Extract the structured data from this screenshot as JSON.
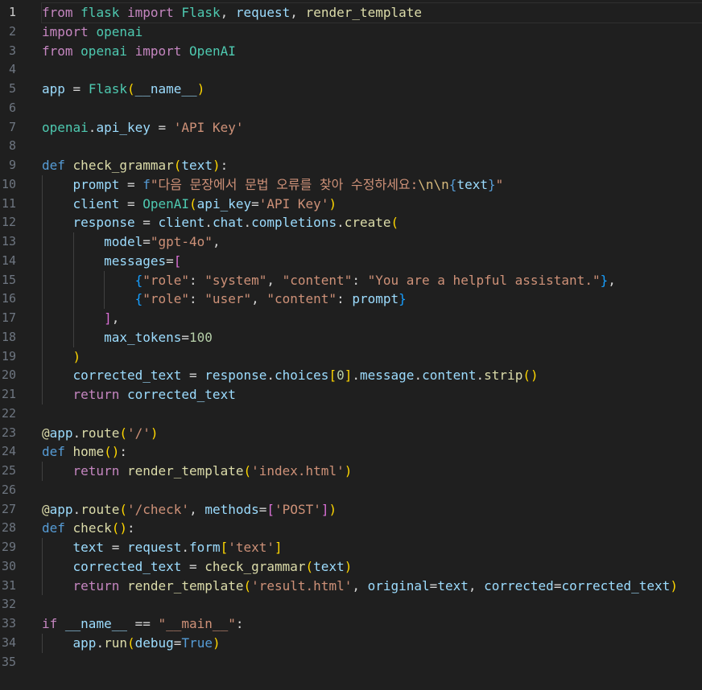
{
  "editor": {
    "language": "python",
    "active_line": 1,
    "colors": {
      "background": "#1f1f1f",
      "keyword_control": "#c586c0",
      "keyword": "#569cd6",
      "function": "#dcdcaa",
      "class": "#4ec9b0",
      "variable": "#9cdcfe",
      "string": "#ce9178",
      "number": "#b5cea8",
      "bracket_level_1": "#ffd700",
      "bracket_level_2": "#da70d6",
      "bracket_level_3": "#179fff"
    },
    "lines": [
      {
        "n": "1",
        "indent": 0,
        "tokens": [
          [
            "kw",
            "from"
          ],
          [
            "op",
            " "
          ],
          [
            "cls",
            "flask"
          ],
          [
            "op",
            " "
          ],
          [
            "kw",
            "import"
          ],
          [
            "op",
            " "
          ],
          [
            "cls",
            "Flask"
          ],
          [
            "op",
            ", "
          ],
          [
            "var",
            "request"
          ],
          [
            "op",
            ", "
          ],
          [
            "fn",
            "render_template"
          ]
        ]
      },
      {
        "n": "2",
        "indent": 0,
        "tokens": [
          [
            "kw",
            "import"
          ],
          [
            "op",
            " "
          ],
          [
            "cls",
            "openai"
          ]
        ]
      },
      {
        "n": "3",
        "indent": 0,
        "tokens": [
          [
            "kw",
            "from"
          ],
          [
            "op",
            " "
          ],
          [
            "cls",
            "openai"
          ],
          [
            "op",
            " "
          ],
          [
            "kw",
            "import"
          ],
          [
            "op",
            " "
          ],
          [
            "cls",
            "OpenAI"
          ]
        ]
      },
      {
        "n": "4",
        "indent": 0,
        "tokens": []
      },
      {
        "n": "5",
        "indent": 0,
        "tokens": [
          [
            "var",
            "app"
          ],
          [
            "op",
            " = "
          ],
          [
            "cls",
            "Flask"
          ],
          [
            "b1",
            "("
          ],
          [
            "var",
            "__name__"
          ],
          [
            "b1",
            ")"
          ]
        ]
      },
      {
        "n": "6",
        "indent": 0,
        "tokens": []
      },
      {
        "n": "7",
        "indent": 0,
        "tokens": [
          [
            "cls",
            "openai"
          ],
          [
            "op",
            "."
          ],
          [
            "var",
            "api_key"
          ],
          [
            "op",
            " = "
          ],
          [
            "str",
            "'API Key'"
          ]
        ]
      },
      {
        "n": "8",
        "indent": 0,
        "tokens": []
      },
      {
        "n": "9",
        "indent": 0,
        "tokens": [
          [
            "kwb",
            "def"
          ],
          [
            "op",
            " "
          ],
          [
            "fn",
            "check_grammar"
          ],
          [
            "b1",
            "("
          ],
          [
            "var",
            "text"
          ],
          [
            "b1",
            ")"
          ],
          [
            "op",
            ":"
          ]
        ]
      },
      {
        "n": "10",
        "indent": 1,
        "tokens": [
          [
            "op",
            "    "
          ],
          [
            "var",
            "prompt"
          ],
          [
            "op",
            " = "
          ],
          [
            "kwb",
            "f"
          ],
          [
            "str",
            "\"다음 문장에서 문법 오류를 찾아 수정하세요:"
          ],
          [
            "esc",
            "\\n\\n"
          ],
          [
            "kwb",
            "{"
          ],
          [
            "var",
            "text"
          ],
          [
            "kwb",
            "}"
          ],
          [
            "str",
            "\""
          ]
        ]
      },
      {
        "n": "11",
        "indent": 1,
        "tokens": [
          [
            "op",
            "    "
          ],
          [
            "var",
            "client"
          ],
          [
            "op",
            " = "
          ],
          [
            "cls",
            "OpenAI"
          ],
          [
            "b1",
            "("
          ],
          [
            "var",
            "api_key"
          ],
          [
            "op",
            "="
          ],
          [
            "str",
            "'API Key'"
          ],
          [
            "b1",
            ")"
          ]
        ]
      },
      {
        "n": "12",
        "indent": 1,
        "tokens": [
          [
            "op",
            "    "
          ],
          [
            "var",
            "response"
          ],
          [
            "op",
            " = "
          ],
          [
            "var",
            "client"
          ],
          [
            "op",
            "."
          ],
          [
            "var",
            "chat"
          ],
          [
            "op",
            "."
          ],
          [
            "var",
            "completions"
          ],
          [
            "op",
            "."
          ],
          [
            "fn",
            "create"
          ],
          [
            "b1",
            "("
          ]
        ]
      },
      {
        "n": "13",
        "indent": 2,
        "tokens": [
          [
            "op",
            "        "
          ],
          [
            "var",
            "model"
          ],
          [
            "op",
            "="
          ],
          [
            "str",
            "\"gpt-4o\""
          ],
          [
            "op",
            ","
          ]
        ]
      },
      {
        "n": "14",
        "indent": 2,
        "tokens": [
          [
            "op",
            "        "
          ],
          [
            "var",
            "messages"
          ],
          [
            "op",
            "="
          ],
          [
            "b2",
            "["
          ]
        ]
      },
      {
        "n": "15",
        "indent": 3,
        "tokens": [
          [
            "op",
            "            "
          ],
          [
            "b3",
            "{"
          ],
          [
            "str",
            "\"role\""
          ],
          [
            "op",
            ": "
          ],
          [
            "str",
            "\"system\""
          ],
          [
            "op",
            ", "
          ],
          [
            "str",
            "\"content\""
          ],
          [
            "op",
            ": "
          ],
          [
            "str",
            "\"You are a helpful assistant.\""
          ],
          [
            "b3",
            "}"
          ],
          [
            "op",
            ","
          ]
        ]
      },
      {
        "n": "16",
        "indent": 3,
        "tokens": [
          [
            "op",
            "            "
          ],
          [
            "b3",
            "{"
          ],
          [
            "str",
            "\"role\""
          ],
          [
            "op",
            ": "
          ],
          [
            "str",
            "\"user\""
          ],
          [
            "op",
            ", "
          ],
          [
            "str",
            "\"content\""
          ],
          [
            "op",
            ": "
          ],
          [
            "var",
            "prompt"
          ],
          [
            "b3",
            "}"
          ]
        ]
      },
      {
        "n": "17",
        "indent": 2,
        "tokens": [
          [
            "op",
            "        "
          ],
          [
            "b2",
            "]"
          ],
          [
            "op",
            ","
          ]
        ]
      },
      {
        "n": "18",
        "indent": 2,
        "tokens": [
          [
            "op",
            "        "
          ],
          [
            "var",
            "max_tokens"
          ],
          [
            "op",
            "="
          ],
          [
            "num",
            "100"
          ]
        ]
      },
      {
        "n": "19",
        "indent": 1,
        "tokens": [
          [
            "op",
            "    "
          ],
          [
            "b1",
            ")"
          ]
        ]
      },
      {
        "n": "20",
        "indent": 1,
        "tokens": [
          [
            "op",
            "    "
          ],
          [
            "var",
            "corrected_text"
          ],
          [
            "op",
            " = "
          ],
          [
            "var",
            "response"
          ],
          [
            "op",
            "."
          ],
          [
            "var",
            "choices"
          ],
          [
            "b1",
            "["
          ],
          [
            "num",
            "0"
          ],
          [
            "b1",
            "]"
          ],
          [
            "op",
            "."
          ],
          [
            "var",
            "message"
          ],
          [
            "op",
            "."
          ],
          [
            "var",
            "content"
          ],
          [
            "op",
            "."
          ],
          [
            "fn",
            "strip"
          ],
          [
            "b1",
            "()"
          ]
        ]
      },
      {
        "n": "21",
        "indent": 1,
        "tokens": [
          [
            "op",
            "    "
          ],
          [
            "kw",
            "return"
          ],
          [
            "op",
            " "
          ],
          [
            "var",
            "corrected_text"
          ]
        ]
      },
      {
        "n": "22",
        "indent": 0,
        "tokens": []
      },
      {
        "n": "23",
        "indent": 0,
        "tokens": [
          [
            "dec",
            "@"
          ],
          [
            "var",
            "app"
          ],
          [
            "op",
            "."
          ],
          [
            "fn",
            "route"
          ],
          [
            "b1",
            "("
          ],
          [
            "str",
            "'/'"
          ],
          [
            "b1",
            ")"
          ]
        ]
      },
      {
        "n": "24",
        "indent": 0,
        "tokens": [
          [
            "kwb",
            "def"
          ],
          [
            "op",
            " "
          ],
          [
            "fn",
            "home"
          ],
          [
            "b1",
            "()"
          ],
          [
            "op",
            ":"
          ]
        ]
      },
      {
        "n": "25",
        "indent": 1,
        "tokens": [
          [
            "op",
            "    "
          ],
          [
            "kw",
            "return"
          ],
          [
            "op",
            " "
          ],
          [
            "fn",
            "render_template"
          ],
          [
            "b1",
            "("
          ],
          [
            "str",
            "'index.html'"
          ],
          [
            "b1",
            ")"
          ]
        ]
      },
      {
        "n": "26",
        "indent": 0,
        "tokens": []
      },
      {
        "n": "27",
        "indent": 0,
        "tokens": [
          [
            "dec",
            "@"
          ],
          [
            "var",
            "app"
          ],
          [
            "op",
            "."
          ],
          [
            "fn",
            "route"
          ],
          [
            "b1",
            "("
          ],
          [
            "str",
            "'/check'"
          ],
          [
            "op",
            ", "
          ],
          [
            "var",
            "methods"
          ],
          [
            "op",
            "="
          ],
          [
            "b2",
            "["
          ],
          [
            "str",
            "'POST'"
          ],
          [
            "b2",
            "]"
          ],
          [
            "b1",
            ")"
          ]
        ]
      },
      {
        "n": "28",
        "indent": 0,
        "tokens": [
          [
            "kwb",
            "def"
          ],
          [
            "op",
            " "
          ],
          [
            "fn",
            "check"
          ],
          [
            "b1",
            "()"
          ],
          [
            "op",
            ":"
          ]
        ]
      },
      {
        "n": "29",
        "indent": 1,
        "tokens": [
          [
            "op",
            "    "
          ],
          [
            "var",
            "text"
          ],
          [
            "op",
            " = "
          ],
          [
            "var",
            "request"
          ],
          [
            "op",
            "."
          ],
          [
            "var",
            "form"
          ],
          [
            "b1",
            "["
          ],
          [
            "str",
            "'text'"
          ],
          [
            "b1",
            "]"
          ]
        ]
      },
      {
        "n": "30",
        "indent": 1,
        "tokens": [
          [
            "op",
            "    "
          ],
          [
            "var",
            "corrected_text"
          ],
          [
            "op",
            " = "
          ],
          [
            "fn",
            "check_grammar"
          ],
          [
            "b1",
            "("
          ],
          [
            "var",
            "text"
          ],
          [
            "b1",
            ")"
          ]
        ]
      },
      {
        "n": "31",
        "indent": 1,
        "tokens": [
          [
            "op",
            "    "
          ],
          [
            "kw",
            "return"
          ],
          [
            "op",
            " "
          ],
          [
            "fn",
            "render_template"
          ],
          [
            "b1",
            "("
          ],
          [
            "str",
            "'result.html'"
          ],
          [
            "op",
            ", "
          ],
          [
            "var",
            "original"
          ],
          [
            "op",
            "="
          ],
          [
            "var",
            "text"
          ],
          [
            "op",
            ", "
          ],
          [
            "var",
            "corrected"
          ],
          [
            "op",
            "="
          ],
          [
            "var",
            "corrected_text"
          ],
          [
            "b1",
            ")"
          ]
        ]
      },
      {
        "n": "32",
        "indent": 0,
        "tokens": []
      },
      {
        "n": "33",
        "indent": 0,
        "tokens": [
          [
            "kw",
            "if"
          ],
          [
            "op",
            " "
          ],
          [
            "var",
            "__name__"
          ],
          [
            "op",
            " == "
          ],
          [
            "str",
            "\"__main__\""
          ],
          [
            "op",
            ":"
          ]
        ]
      },
      {
        "n": "34",
        "indent": 1,
        "tokens": [
          [
            "op",
            "    "
          ],
          [
            "var",
            "app"
          ],
          [
            "op",
            "."
          ],
          [
            "fn",
            "run"
          ],
          [
            "b1",
            "("
          ],
          [
            "var",
            "debug"
          ],
          [
            "op",
            "="
          ],
          [
            "kwb",
            "True"
          ],
          [
            "b1",
            ")"
          ]
        ]
      },
      {
        "n": "35",
        "indent": 0,
        "tokens": []
      }
    ]
  }
}
